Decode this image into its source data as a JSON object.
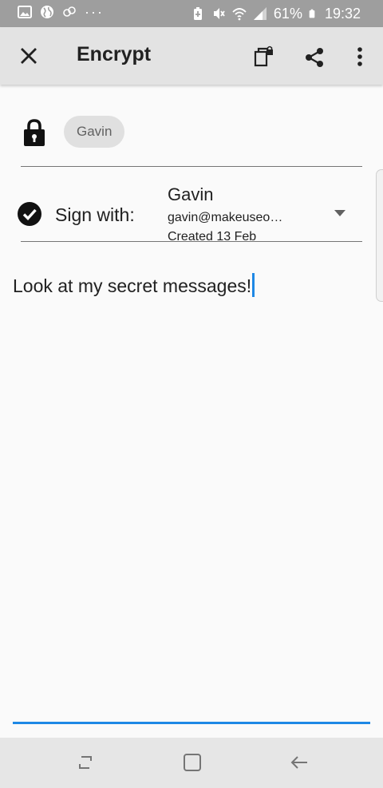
{
  "status_bar": {
    "dots": "···",
    "battery_percent": "61%",
    "time": "19:32",
    "icons": [
      "image-icon",
      "globe-icon",
      "sync-icon",
      "battery-saver-icon",
      "mute-icon",
      "wifi-icon",
      "signal-icon",
      "battery-icon"
    ]
  },
  "app_bar": {
    "title": "Encrypt",
    "icons": [
      "close-icon",
      "encrypt-file-icon",
      "share-icon",
      "more-vert-icon"
    ]
  },
  "recipients": {
    "chips": [
      "Gavin"
    ]
  },
  "sign": {
    "label": "Sign with:",
    "name": "Gavin",
    "email": "gavin@makeuseo…",
    "created": "Created 13 Feb"
  },
  "message": {
    "text": "Look at my secret messages!"
  },
  "colors": {
    "status_bar": "#9e9e9e",
    "app_bar": "#e3e3e3",
    "accent": "#1e88e5",
    "background": "#fafafa",
    "chip": "#e0e0e0"
  }
}
